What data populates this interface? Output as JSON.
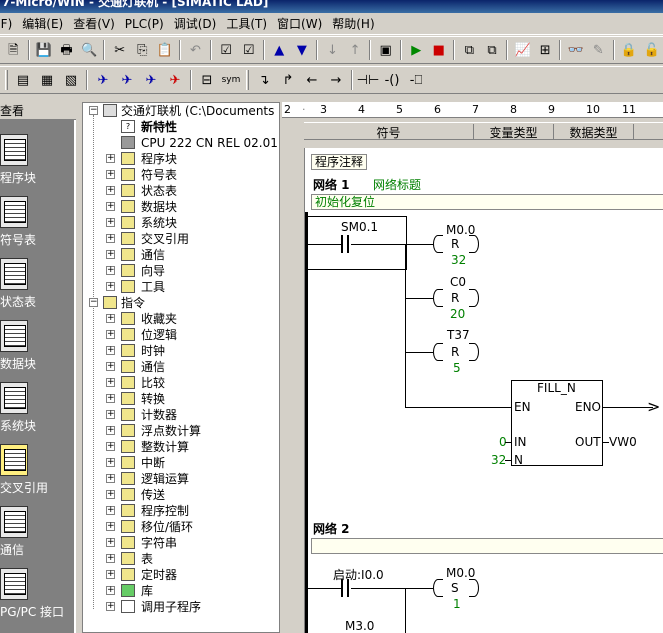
{
  "title": "7-Micro/WIN - 交通灯联机 - [SIMATIC LAD]",
  "menu": [
    "(F)",
    "编辑(E)",
    "查看(V)",
    "PLC(P)",
    "调试(D)",
    "工具(T)",
    "窗口(W)",
    "帮助(H)"
  ],
  "nav": {
    "header": "查看",
    "items": [
      "程序块",
      "符号表",
      "状态表",
      "数据块",
      "系统块",
      "交叉引用",
      "通信",
      "PG/PC 接口"
    ]
  },
  "tree": {
    "project": "交通灯联机 (C:\\Documents and",
    "items": [
      {
        "label": "新特性",
        "bold": true
      },
      {
        "label": "CPU 222 CN REL 02.01"
      },
      {
        "label": "程序块"
      },
      {
        "label": "符号表"
      },
      {
        "label": "状态表"
      },
      {
        "label": "数据块"
      },
      {
        "label": "系统块"
      },
      {
        "label": "交叉引用"
      },
      {
        "label": "通信"
      },
      {
        "label": "向导"
      },
      {
        "label": "工具"
      }
    ],
    "instructions": "指令",
    "instr_items": [
      "收藏夹",
      "位逻辑",
      "时钟",
      "通信",
      "比较",
      "转换",
      "计数器",
      "浮点数计算",
      "整数计算",
      "中断",
      "逻辑运算",
      "传送",
      "程序控制",
      "移位/循环",
      "字符串",
      "表",
      "定时器",
      "库",
      "调用子程序"
    ]
  },
  "ruler": [
    "2",
    "3",
    "4",
    "5",
    "6",
    "7",
    "8",
    "9",
    "10",
    "11"
  ],
  "symtable": {
    "cols": [
      "符号",
      "变量类型",
      "数据类型"
    ]
  },
  "ladder": {
    "program_comment": "程序注释",
    "network1": {
      "label": "网络 1",
      "title": "网络标题",
      "comment": "初始化复位",
      "contact": "SM0.1",
      "coils": [
        {
          "addr": "M0.0",
          "op": "R",
          "n": "32"
        },
        {
          "addr": "C0",
          "op": "R",
          "n": "20"
        },
        {
          "addr": "T37",
          "op": "R",
          "n": "5"
        }
      ],
      "box": {
        "name": "FILL_N",
        "en": "EN",
        "eno": "ENO",
        "in": "IN",
        "in_val": "0",
        "n": "N",
        "n_val": "32",
        "out": "OUT",
        "out_val": "VW0"
      }
    },
    "network2": {
      "label": "网络 2",
      "contact1": "启动:I0.0",
      "coil": {
        "addr": "M0.0",
        "op": "S",
        "n": "1"
      },
      "contact2": "M3.0"
    }
  }
}
